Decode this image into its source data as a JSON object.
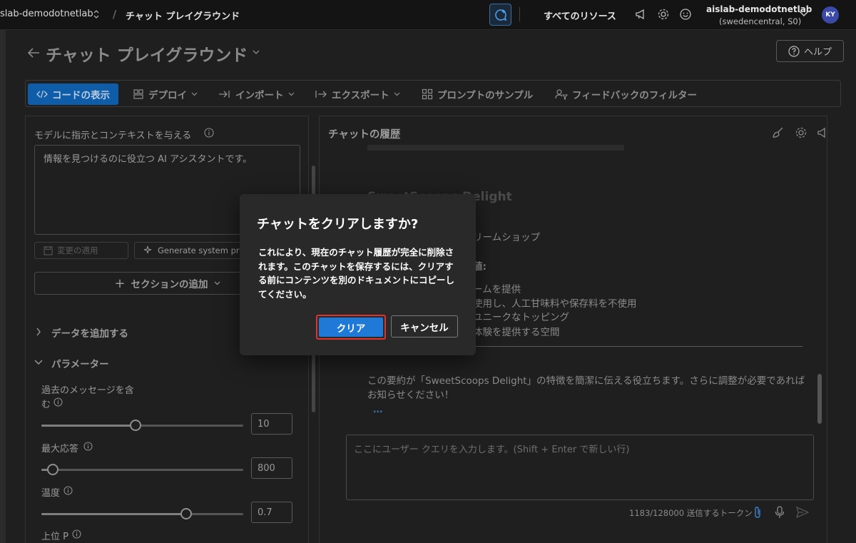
{
  "topbar": {
    "project": "slab-demodotnetlab",
    "separator": "/",
    "page": "チャット プレイグラウンド",
    "all_resources": "すべてのリソース",
    "account_name": "aislab-demodotnetlab",
    "account_region": "(swedencentral, S0)",
    "avatar_initials": "KY"
  },
  "header": {
    "title": "チャット プレイグラウンド",
    "help_label": "ヘルプ"
  },
  "toolbar": {
    "view_code": "コードの表示",
    "deploy": "デプロイ",
    "import": "インポート",
    "export": "エクスポート",
    "prompt_samples": "プロンプトのサンプル",
    "feedback_filter": "フィードバックのフィルター"
  },
  "setup": {
    "instructions_label": "モデルに指示とコンテキストを与える",
    "system_message": "情報を見つけるのに役立つ AI アシスタントです。",
    "apply_changes": "変更の適用",
    "generate_prompt": "Generate system pr",
    "add_section": "セクションの追加",
    "add_data": "データを追加する",
    "parameters": "パラメーター",
    "past_messages_label_1": "過去のメッセージを含",
    "past_messages_label_2": "む",
    "past_messages_value": "10",
    "past_messages_fraction": 0.45,
    "max_response_label": "最大応答",
    "max_response_value": "800",
    "max_response_fraction": 0.04,
    "temperature_label": "温度",
    "temperature_value": "0.7",
    "temperature_fraction": 0.7,
    "top_p_label": "上位 P"
  },
  "chat": {
    "history_title": "チャットの履歴",
    "line_heading": "SweetScoops Delight",
    "line_shop": "リームショップ",
    "line_values": "値:",
    "line_item_1": "ームを提供",
    "line_item_2": "使用し、人工甘味料や保存料を不使用",
    "line_item_3": "ユニークなトッピング",
    "line_item_4": "体験を提供する空間",
    "summary_1": "この要約が「SweetScoops Delight」の特徴を簡潔に伝える役立ちます。さらに調整が必要であれば",
    "summary_2": "お知らせください！",
    "ellipsis": "…",
    "input_placeholder": "ここにユーザー クエリを入力します。(Shift + Enter で新しい行)",
    "token_count": "1183/128000 送信するトークン"
  },
  "dialog": {
    "title": "チャットをクリアしますか?",
    "body": "これにより、現在のチャット履歴が完全に削除されます。このチャットを保存するには、クリアする前にコンテンツを別のドキュメントにコピーしてください。",
    "clear_label": "クリア",
    "cancel_label": "キャンセル"
  },
  "colors": {
    "accent": "#1e7ad6",
    "highlight_border": "#e0322f",
    "avatar_bg": "#3b4aa8"
  }
}
